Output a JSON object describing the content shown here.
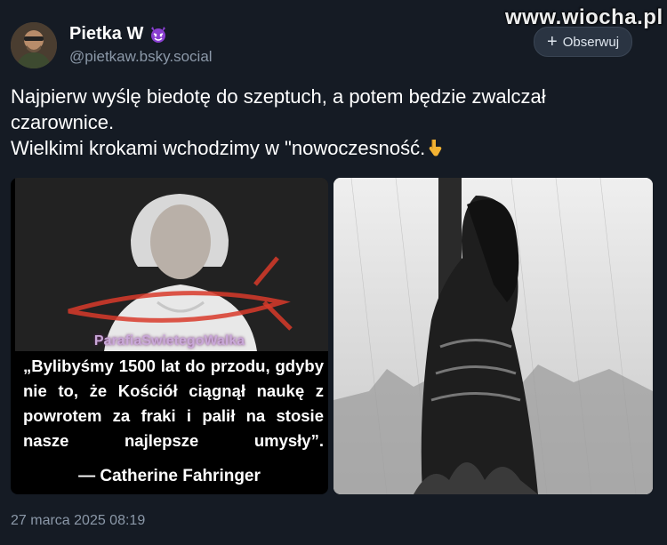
{
  "watermark": "www.wiocha.pl",
  "post": {
    "author": {
      "display_name": "Pietka W",
      "handle": "@pietkaw.bsky.social",
      "badge_icon": "devil-emoji-icon",
      "avatar_icon": "avatar-photo"
    },
    "follow_button": {
      "label": "Obserwuj",
      "icon": "plus-icon"
    },
    "text_line_1": "Najpierw wyślę biedotę do szeptuch, a potem będzie zwalczał czarownice.",
    "text_line_2": "Wielkimi krokami wchodzimy w \"nowoczesność.",
    "text_line_2_emoji": "pointing-down-emoji-icon",
    "timestamp": "27 marca 2025 08:19"
  },
  "images": {
    "left": {
      "overlay_label": "ParafiaSwietegoWalka",
      "quote": "„Bylibyśmy 1500 lat do przodu, gdyby nie to, że Kościół ciągnął naukę z powrotem za fraki i palił na stosie nasze najlepsze umysły”.",
      "author": "— Catherine Fahringer"
    },
    "right": {
      "description_icon": "woman-tied-to-stake-illustration"
    }
  },
  "colors": {
    "background": "#151b24",
    "secondary_text": "#8b98a8",
    "follow_bg": "#2a3442"
  }
}
